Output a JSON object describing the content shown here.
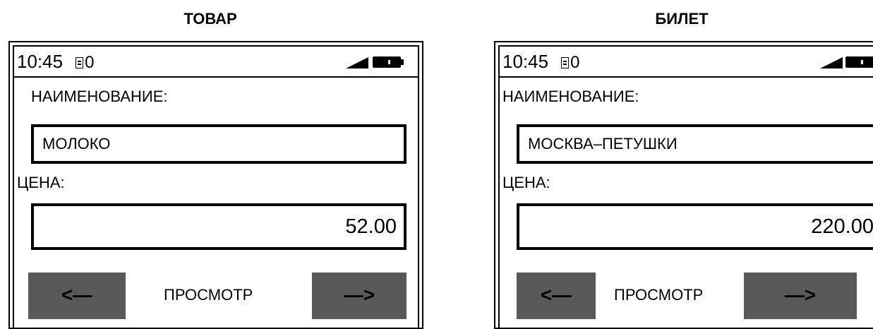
{
  "panels": [
    {
      "heading": "ТОВАР",
      "status": {
        "time": "10:45",
        "doc_icon": "document-icon",
        "counter": "0",
        "signal_icon": "signal-icon",
        "battery_icon": "battery-icon"
      },
      "name_label": "НАИМЕНОВАНИЕ:",
      "name_value": "МОЛОКО",
      "price_label": "ЦЕНА:",
      "price_value": "52.00",
      "prev_label": "<—",
      "view_label": "ПРОСМОТР",
      "next_label": "—>"
    },
    {
      "heading": "БИЛЕТ",
      "status": {
        "time": "10:45",
        "doc_icon": "document-icon",
        "counter": "0",
        "signal_icon": "signal-icon",
        "battery_icon": "battery-icon"
      },
      "name_label": "НАИМЕНОВАНИЕ:",
      "name_value": "МОСКВА–ПЕТУШКИ",
      "price_label": "ЦЕНА:",
      "price_value": "220.00",
      "prev_label": "<—",
      "view_label": "ПРОСМОТР",
      "next_label": "—>"
    }
  ],
  "colors": {
    "button_bg": "#595959",
    "border": "#000000",
    "background": "#ffffff"
  }
}
